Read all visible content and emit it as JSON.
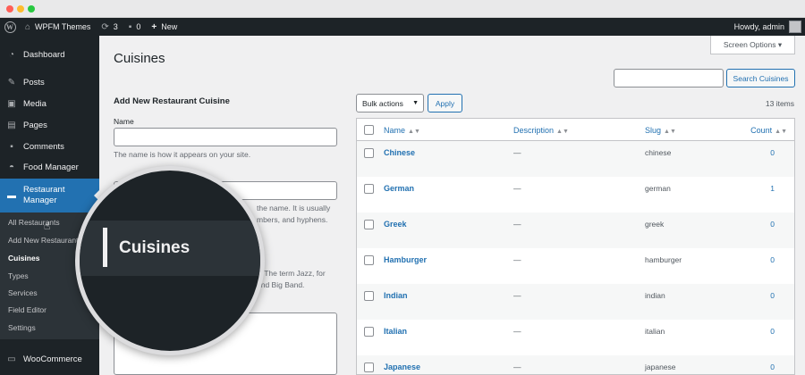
{
  "adminbar": {
    "site_name": "WPFM Themes",
    "updates_count": "3",
    "comments_count": "0",
    "new_label": "New",
    "howdy": "Howdy, admin"
  },
  "sidebar": {
    "items": [
      {
        "label": "Dashboard",
        "icon": "dashboard-icon"
      },
      {
        "label": "Posts",
        "icon": "pin-icon"
      },
      {
        "label": "Media",
        "icon": "media-icon"
      },
      {
        "label": "Pages",
        "icon": "pages-icon"
      },
      {
        "label": "Comments",
        "icon": "comment-icon"
      },
      {
        "label": "Food Manager",
        "icon": "food-icon"
      },
      {
        "label": "Restaurant Manager",
        "icon": "restaurant-icon"
      },
      {
        "label": "WooCommerce",
        "icon": "woo-icon"
      }
    ],
    "submenu": [
      "All Restaurants",
      "Add New Restaurant",
      "Cuisines",
      "Types",
      "Services",
      "Field Editor",
      "Settings"
    ]
  },
  "screen_options": "Screen Options ▾",
  "page_title": "Cuisines",
  "search": {
    "button": "Search Cuisines"
  },
  "form": {
    "heading": "Add New Restaurant Cuisine",
    "name_label": "Name",
    "name_help": "The name is how it appears on your site.",
    "slug_help_1": "the name. It is usually",
    "slug_help_2": "mbers, and hyphens.",
    "parent_help_1": "y. The term Jazz, for",
    "parent_help_2": "and Big Band."
  },
  "bulk": {
    "select": "Bulk actions",
    "apply": "Apply",
    "items_count": "13 items"
  },
  "table": {
    "headers": {
      "name": "Name",
      "description": "Description",
      "slug": "Slug",
      "count": "Count"
    },
    "rows": [
      {
        "name": "Chinese",
        "description": "—",
        "slug": "chinese",
        "count": "0"
      },
      {
        "name": "German",
        "description": "—",
        "slug": "german",
        "count": "1"
      },
      {
        "name": "Greek",
        "description": "—",
        "slug": "greek",
        "count": "0"
      },
      {
        "name": "Hamburger",
        "description": "—",
        "slug": "hamburger",
        "count": "0"
      },
      {
        "name": "Indian",
        "description": "—",
        "slug": "indian",
        "count": "0"
      },
      {
        "name": "Italian",
        "description": "—",
        "slug": "italian",
        "count": "0"
      },
      {
        "name": "Japanese",
        "description": "—",
        "slug": "japanese",
        "count": "0"
      }
    ]
  },
  "magnifier": {
    "label": "Cuisines"
  }
}
